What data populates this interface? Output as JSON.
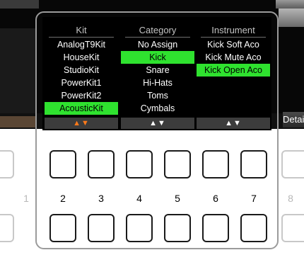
{
  "popup": {
    "columns": [
      {
        "header": "Kit",
        "items": [
          "AnalogT9Kit",
          "HouseKit",
          "StudioKit",
          "PowerKit1",
          "PowerKit2",
          "AcousticKit"
        ],
        "selected_index": 5,
        "arrows": "▲▼",
        "arrows_color": "#ff7a1a"
      },
      {
        "header": "Category",
        "items": [
          "No Assign",
          "Kick",
          "Snare",
          "Hi-Hats",
          "Toms",
          "Cymbals"
        ],
        "selected_index": 1,
        "arrows": "▲▼",
        "arrows_color": "#ffffff"
      },
      {
        "header": "Instrument",
        "items": [
          "Kick Soft Aco",
          "Kick Mute Aco",
          "Kick Open Aco"
        ],
        "selected_index": 2,
        "arrows": "▲▼",
        "arrows_color": "#ffffff"
      }
    ],
    "selection_color": "#2fe22f"
  },
  "screen": {
    "detail_label": "Detail"
  },
  "panel_buttons": {
    "numbers": [
      "1",
      "2",
      "3",
      "4",
      "5",
      "6",
      "7",
      "8"
    ]
  }
}
